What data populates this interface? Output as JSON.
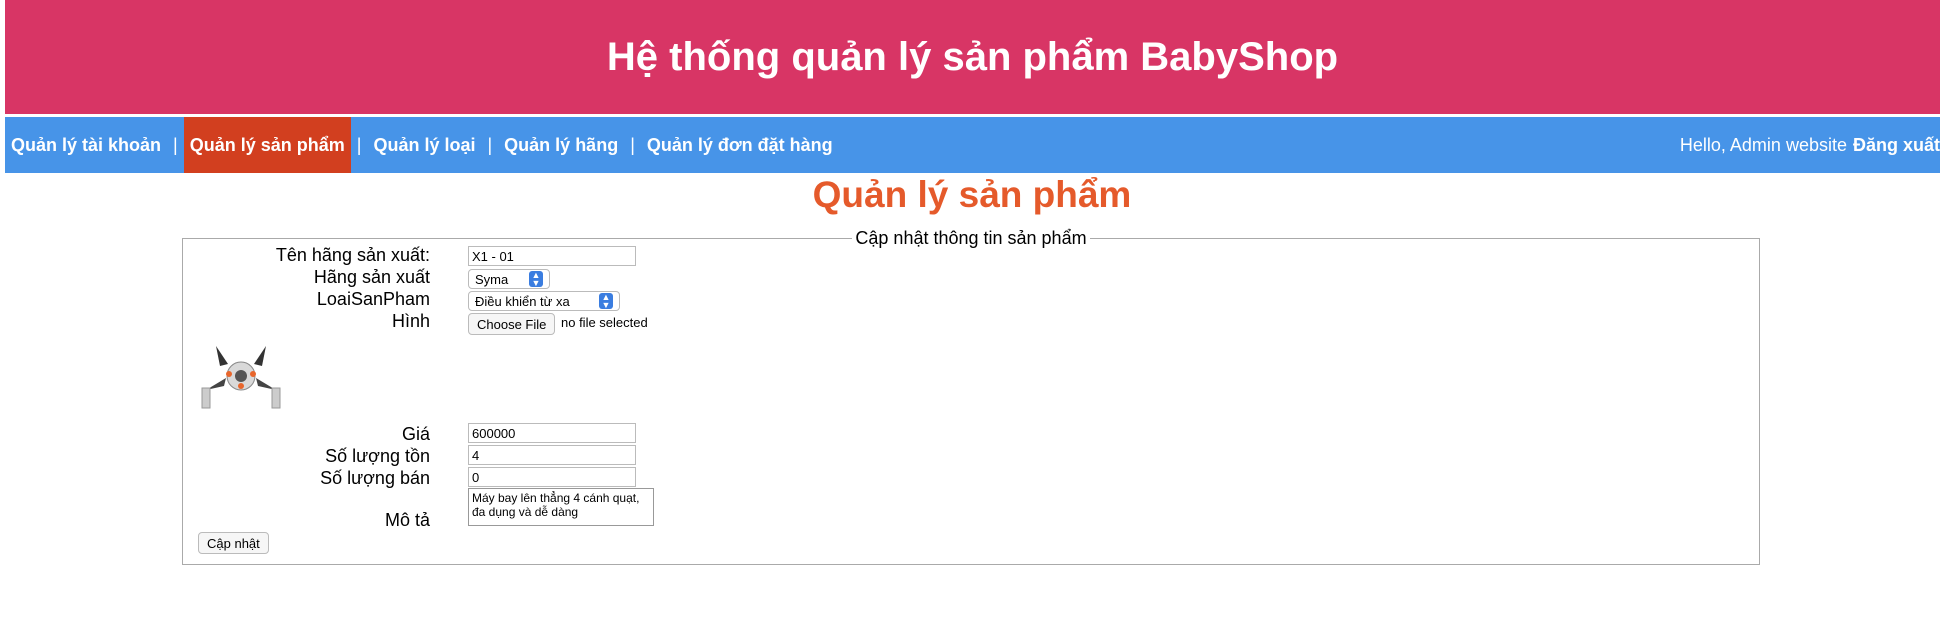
{
  "header": {
    "title": "Hệ thống quản lý sản phẩm BabyShop"
  },
  "nav": {
    "items": [
      {
        "label": "Quản lý tài khoản"
      },
      {
        "label": "Quản lý sản phẩm"
      },
      {
        "label": "Quản lý loại"
      },
      {
        "label": "Quản lý hãng"
      },
      {
        "label": "Quản lý đơn đặt hàng"
      }
    ],
    "separator": "|",
    "greeting": "Hello, Admin website",
    "logout": "Đăng xuất"
  },
  "page": {
    "title": "Quản lý sản phẩm"
  },
  "form": {
    "legend": "Cập nhật thông tin sản phẩm",
    "name_label": "Tên hãng sản xuất:",
    "name_value": "X1 - 01",
    "brand_label": "Hãng sản xuất",
    "brand_value": "Syma",
    "category_label": "LoaiSanPham",
    "category_value": "Điều khiển từ xa",
    "image_label": "Hình",
    "file_button": "Choose File",
    "file_status": "no file selected",
    "price_label": "Giá",
    "price_value": "600000",
    "stock_label": "Số lượng tồn",
    "stock_value": "4",
    "sold_label": "Số lượng bán",
    "sold_value": "0",
    "desc_label": "Mô tả",
    "desc_value": "Máy bay lên thẳng 4 cánh quạt, đa dụng và dễ dàng",
    "submit_label": "Cập nhật"
  },
  "colors": {
    "header_bg": "#d83565",
    "nav_bg": "#4794e8",
    "nav_active_bg": "#d23f1f",
    "title_color": "#e55a2b"
  }
}
